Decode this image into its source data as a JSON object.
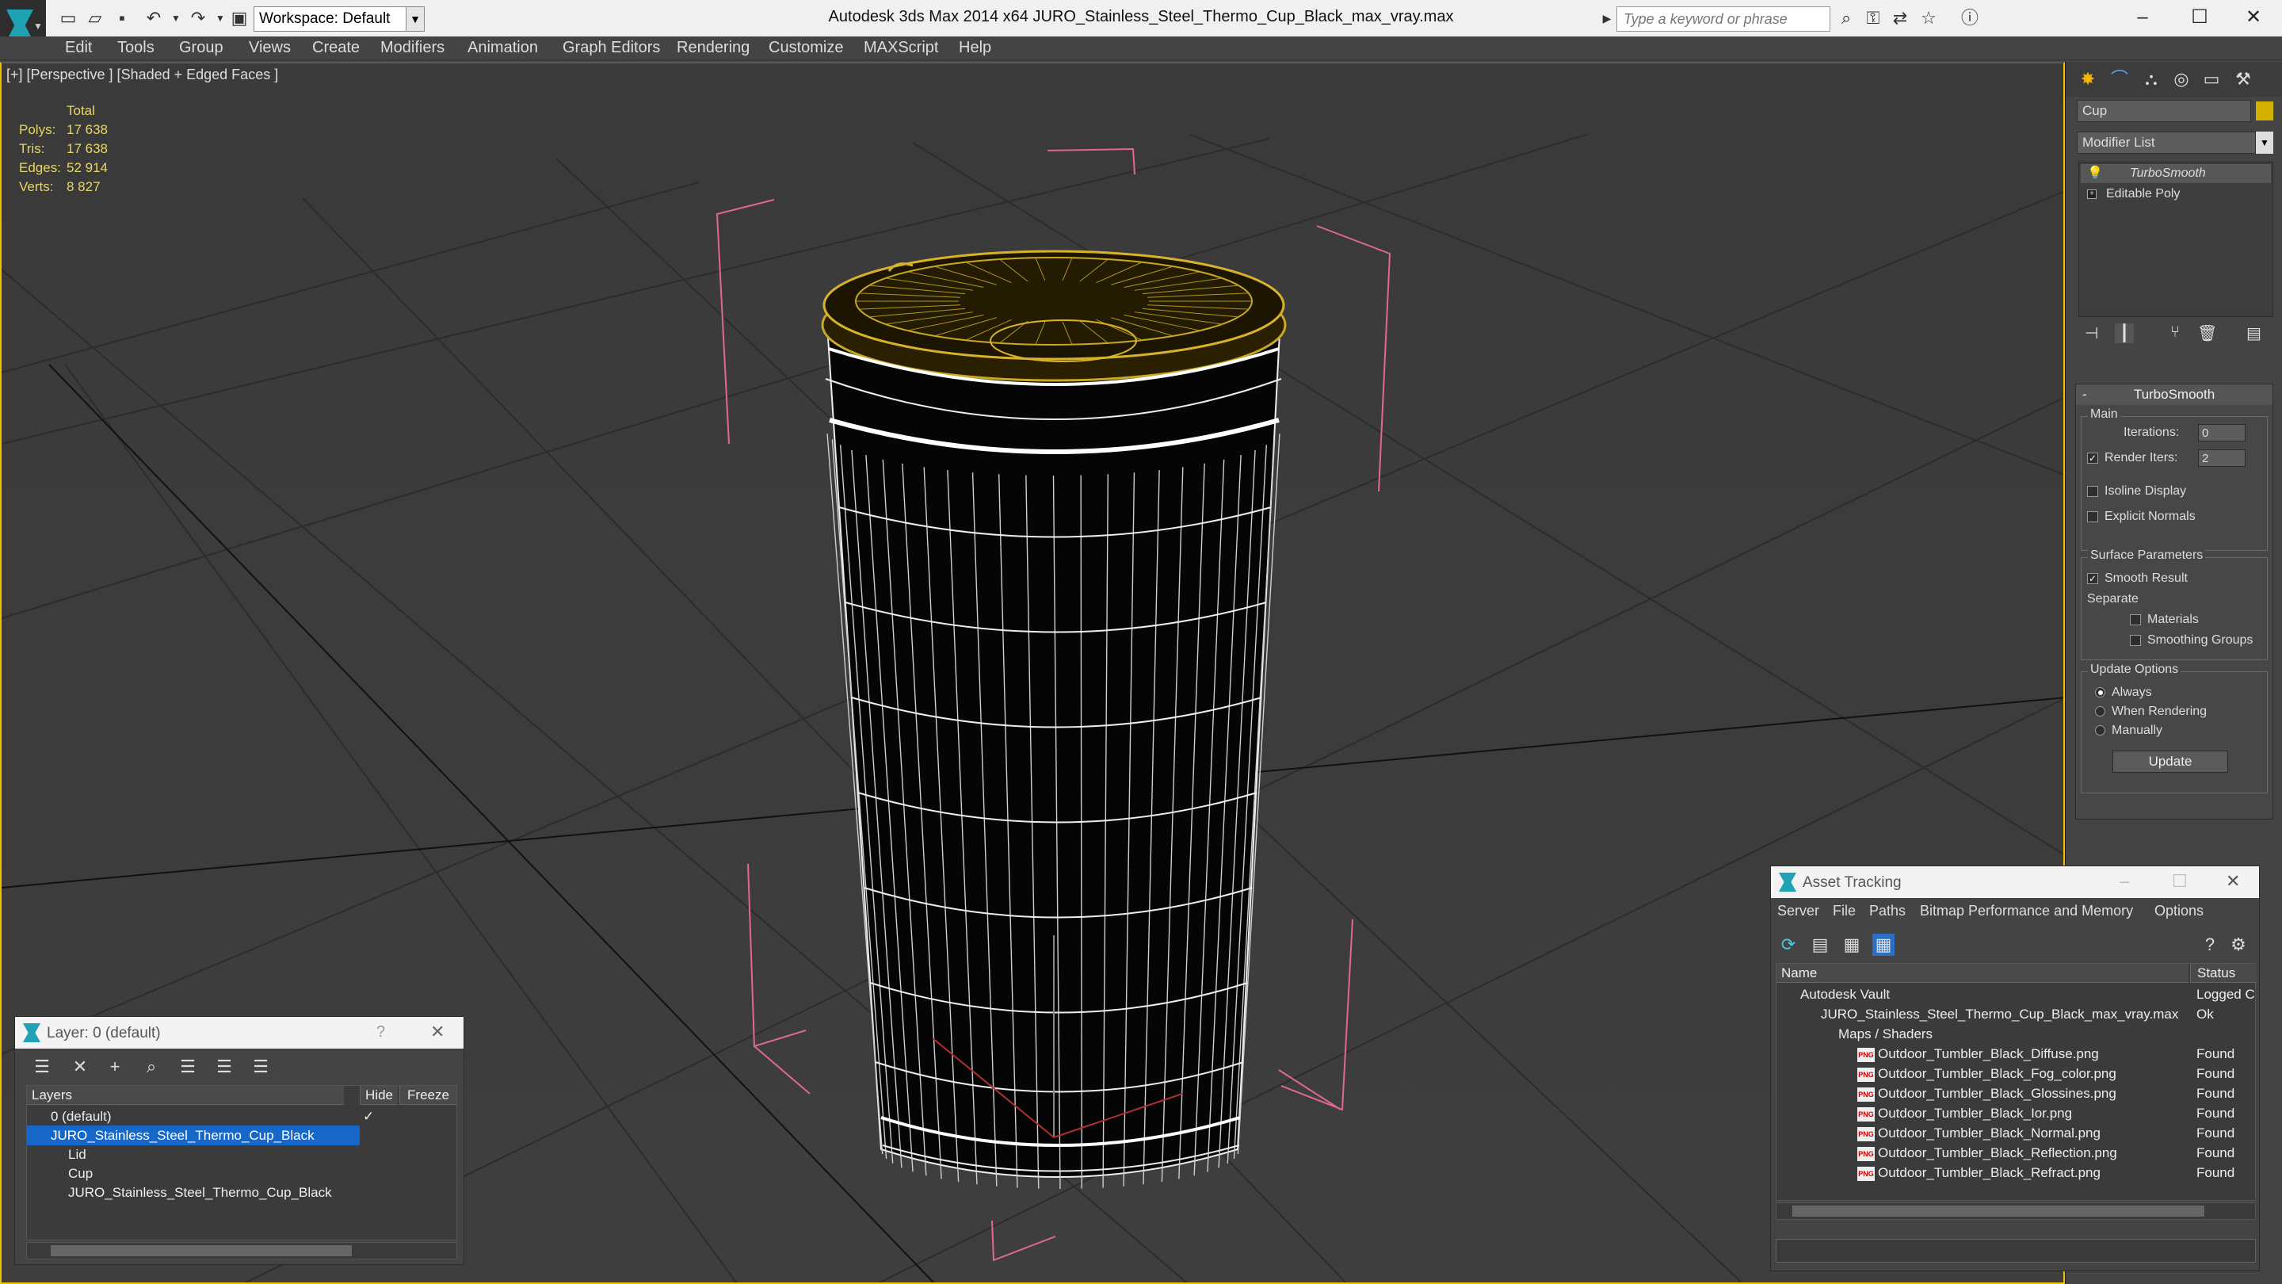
{
  "app": {
    "title": "Autodesk 3ds Max  2014 x64      JURO_Stainless_Steel_Thermo_Cup_Black_max_vray.max",
    "workspace": "Workspace: Default",
    "search_placeholder": "Type a keyword or phrase"
  },
  "menu": [
    "Edit",
    "Tools",
    "Group",
    "Views",
    "Create",
    "Modifiers",
    "Animation",
    "Graph Editors",
    "Rendering",
    "Customize",
    "MAXScript",
    "Help"
  ],
  "viewport": {
    "label": "[+] [Perspective ] [Shaded + Edged Faces ]",
    "stats": {
      "header": "Total",
      "polys_label": "Polys:",
      "polys": "17 638",
      "tris_label": "Tris:",
      "tris": "17 638",
      "edges_label": "Edges:",
      "edges": "52 914",
      "verts_label": "Verts:",
      "verts": "8 827"
    }
  },
  "command_panel": {
    "object_name": "Cup",
    "modifier_list": "Modifier List",
    "stack": [
      "TurboSmooth",
      "Editable Poly"
    ],
    "turbosmooth": {
      "title": "TurboSmooth",
      "main_label": "Main",
      "iterations_label": "Iterations:",
      "iterations": "0",
      "render_iters_label": "Render Iters:",
      "render_iters": "2",
      "isoline": "Isoline Display",
      "explicit_normals": "Explicit Normals",
      "surface_label": "Surface Parameters",
      "smooth_result": "Smooth Result",
      "separate_label": "Separate",
      "materials": "Materials",
      "smoothing_groups": "Smoothing Groups",
      "update_label": "Update Options",
      "always": "Always",
      "when_rendering": "When Rendering",
      "manually": "Manually",
      "update_button": "Update"
    }
  },
  "layer_window": {
    "title": "Layer: 0 (default)",
    "help": "?",
    "col_layers": "Layers",
    "col_hide": "Hide",
    "col_freeze": "Freeze",
    "rows": [
      {
        "name": "0 (default)"
      },
      {
        "name": "JURO_Stainless_Steel_Thermo_Cup_Black"
      },
      {
        "name": "Lid"
      },
      {
        "name": "Cup"
      },
      {
        "name": "JURO_Stainless_Steel_Thermo_Cup_Black"
      }
    ]
  },
  "asset_window": {
    "title": "Asset Tracking",
    "menu": [
      "Server",
      "File",
      "Paths",
      "Bitmap Performance and Memory",
      "Options"
    ],
    "col_name": "Name",
    "col_status": "Status",
    "rows": [
      {
        "name": "Autodesk Vault",
        "status": "Logged C"
      },
      {
        "name": "JURO_Stainless_Steel_Thermo_Cup_Black_max_vray.max",
        "status": "Ok"
      },
      {
        "name": "Maps / Shaders",
        "status": ""
      },
      {
        "name": "Outdoor_Tumbler_Black_Diffuse.png",
        "status": "Found"
      },
      {
        "name": "Outdoor_Tumbler_Black_Fog_color.png",
        "status": "Found"
      },
      {
        "name": "Outdoor_Tumbler_Black_Glossines.png",
        "status": "Found"
      },
      {
        "name": "Outdoor_Tumbler_Black_Ior.png",
        "status": "Found"
      },
      {
        "name": "Outdoor_Tumbler_Black_Normal.png",
        "status": "Found"
      },
      {
        "name": "Outdoor_Tumbler_Black_Reflection.png",
        "status": "Found"
      },
      {
        "name": "Outdoor_Tumbler_Black_Refract.png",
        "status": "Found"
      }
    ]
  },
  "icons": {
    "png_badge": "PNG"
  }
}
